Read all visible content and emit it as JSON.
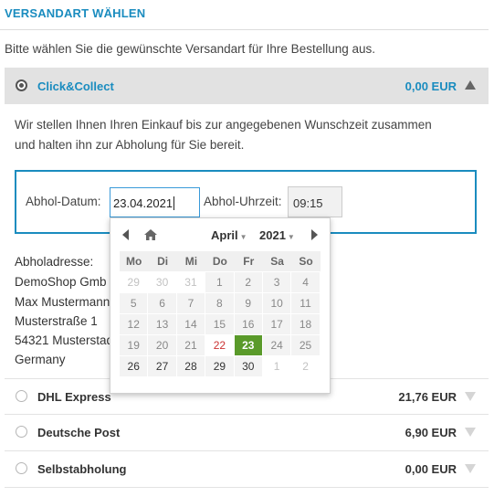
{
  "section_title": "VERSANDART WÄHLEN",
  "intro_text": "Bitte wählen Sie die gewünschte Versandart für Ihre Bestellung aus.",
  "accent_color": "#1a8cbf",
  "selected_day_color": "#5a9a2a",
  "shipping_options": [
    {
      "name": "Click&Collect",
      "price": "0,00 EUR",
      "selected": true
    },
    {
      "name": "DHL Express",
      "price": "21,76 EUR",
      "selected": false
    },
    {
      "name": "Deutsche Post",
      "price": "6,90 EUR",
      "selected": false
    },
    {
      "name": "Selbstabholung",
      "price": "0,00 EUR",
      "selected": false
    }
  ],
  "click_collect": {
    "description_line1": "Wir stellen Ihnen Ihren Einkauf bis zur angegebenen Wunschzeit zusammen",
    "description_line2": "und halten ihn zur Abholung für Sie bereit.",
    "date_label": "Abhol-Datum:",
    "date_value": "23.04.2021",
    "time_label": "Abhol-Uhrzeit:",
    "time_value": "09:15",
    "address_label": "Abholadresse:",
    "address_lines": [
      "DemoShop Gmb",
      "Max Mustermann",
      "Musterstraße 1",
      "54321 Musterstad",
      "Germany"
    ]
  },
  "datepicker": {
    "month": "April",
    "year": "2021",
    "weekdays": [
      "Mo",
      "Di",
      "Mi",
      "Do",
      "Fr",
      "Sa",
      "So"
    ],
    "weeks": [
      [
        "29",
        "30",
        "31",
        "1",
        "2",
        "3",
        "4"
      ],
      [
        "5",
        "6",
        "7",
        "8",
        "9",
        "10",
        "11"
      ],
      [
        "12",
        "13",
        "14",
        "15",
        "16",
        "17",
        "18"
      ],
      [
        "19",
        "20",
        "21",
        "22",
        "23",
        "24",
        "25"
      ],
      [
        "26",
        "27",
        "28",
        "29",
        "30",
        "1",
        "2"
      ]
    ],
    "today": "22",
    "selected": "23"
  },
  "icons": {
    "prev": "chevron-left-icon",
    "next": "chevron-right-icon",
    "home": "home-icon",
    "expand": "triangle-up-icon",
    "collapse": "triangle-down-icon"
  }
}
